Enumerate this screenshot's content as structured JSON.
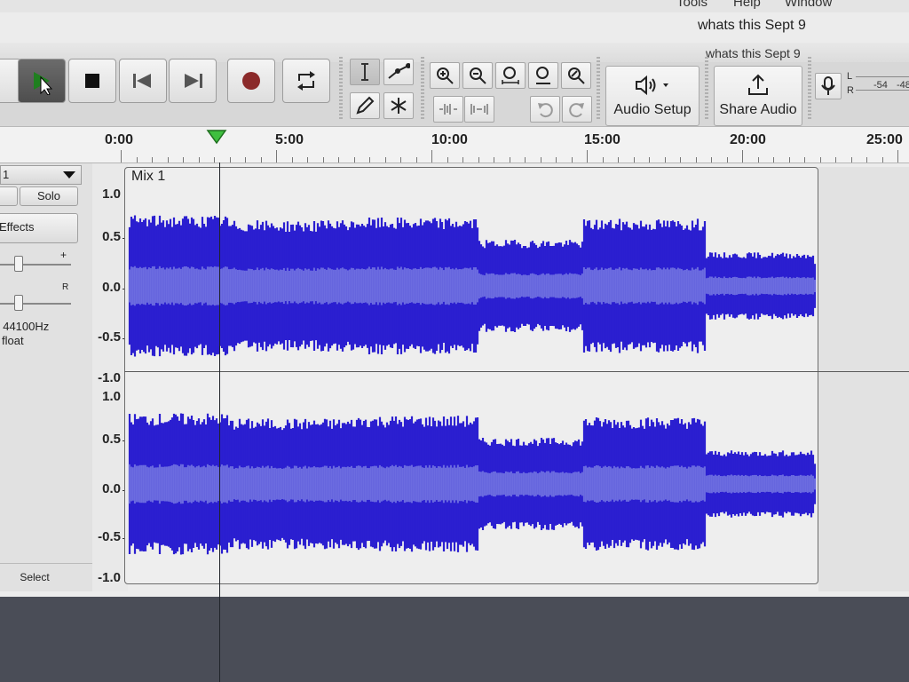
{
  "menubar": {
    "items": [
      "Tools",
      "Help",
      "Window"
    ]
  },
  "window": {
    "title": "whats this Sept 9",
    "subtitle": "whats this Sept 9"
  },
  "toolbar": {
    "transport": [
      "play",
      "stop",
      "skip-to-start",
      "skip-to-end",
      "record",
      "loop"
    ],
    "audio_setup_label": "Audio Setup",
    "share_audio_label": "Share Audio",
    "meter": {
      "l": "L",
      "r": "R",
      "ticks": [
        "-54",
        "-48"
      ]
    }
  },
  "ruler": {
    "labels": [
      "0:00",
      "5:00",
      "10:00",
      "15:00",
      "20:00",
      "25:00"
    ]
  },
  "track": {
    "name": "1",
    "solo_label": "Solo",
    "effects_label": "Effects",
    "gain_plus": "+",
    "pan_r": "R",
    "format_rate": ", 44100Hz",
    "format_type": "float",
    "select_label": "Select",
    "clip_name": "Mix 1",
    "scale_top": [
      "1.0",
      "0.5",
      "0.0",
      "-0.5",
      "-1.0"
    ],
    "scale_bottom": [
      "1.0",
      "0.5",
      "0.0",
      "-0.5",
      "-1.0"
    ]
  },
  "colors": {
    "wave": "#2b1fd0",
    "wave_rms": "#6c6ce0",
    "clip_bg": "#eeeeee"
  }
}
